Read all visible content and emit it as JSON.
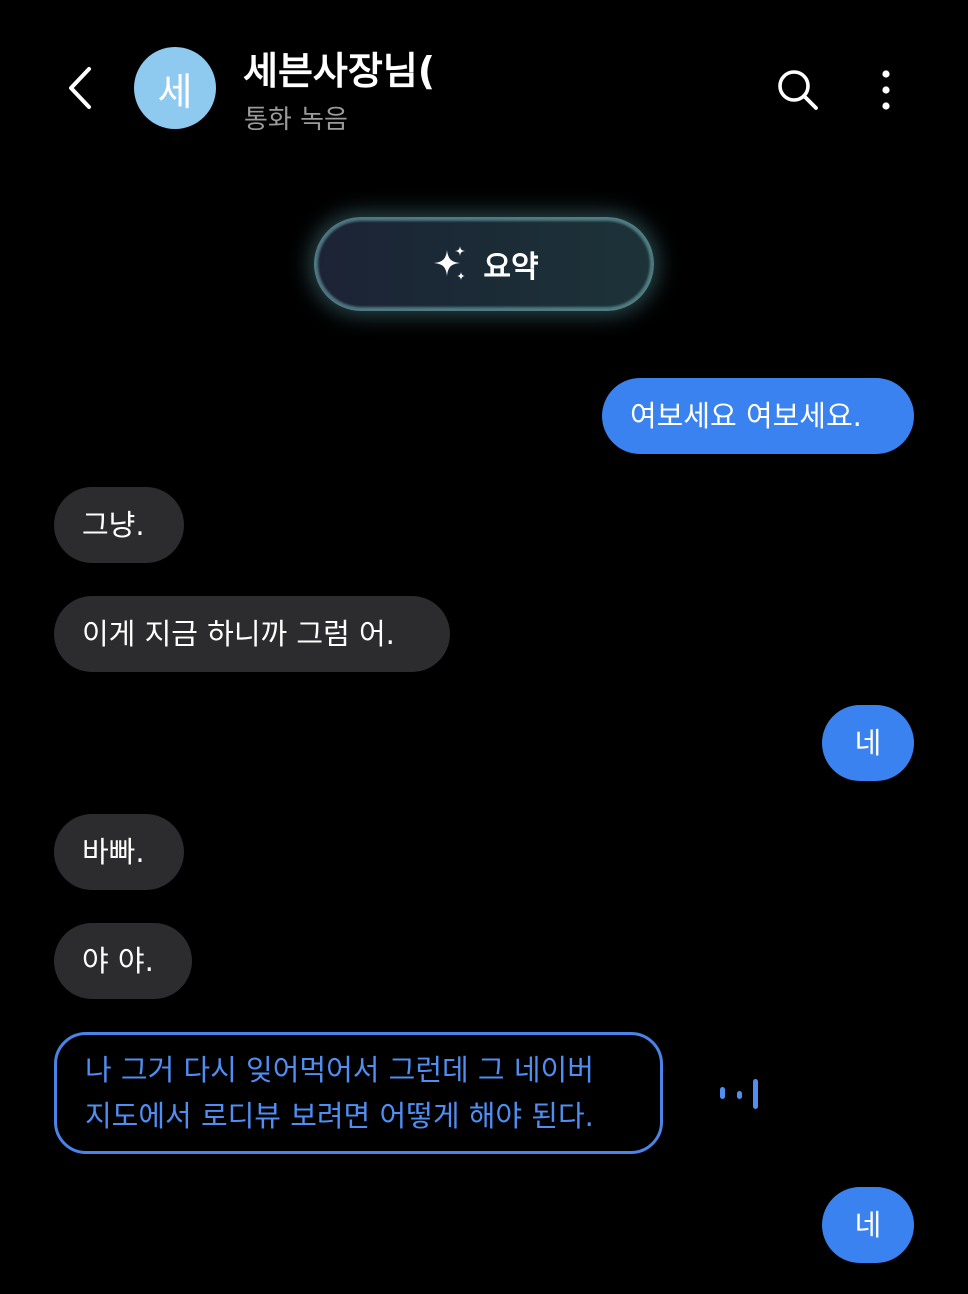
{
  "header": {
    "avatar_initial": "세",
    "contact_name": "세븐사장님(",
    "subtitle": "통화 녹음"
  },
  "summary": {
    "label": "요약"
  },
  "messages": [
    {
      "from": "me",
      "text": "여보세요 여보세요."
    },
    {
      "from": "them",
      "text": "그냥."
    },
    {
      "from": "them",
      "text": "이게 지금 하니까 그럼 어."
    },
    {
      "from": "me",
      "text": "네"
    },
    {
      "from": "them",
      "text": "바빠."
    },
    {
      "from": "them",
      "text": "야 야."
    },
    {
      "from": "them",
      "lines": [
        "나 그거 다시 잊어먹어서 그런데 그 네이버",
        "지도에서 로디뷰 보려면 어떻게 해야 된다."
      ],
      "state": "playing"
    },
    {
      "from": "me",
      "text": "네"
    }
  ],
  "icons": {
    "back": "chevron-left-icon",
    "search": "search-icon",
    "more": "more-vertical-icon",
    "summary": "sparkle-icon",
    "playing": "audio-playing-icon"
  },
  "colors": {
    "background": "#000000",
    "my_bubble": "#3a82f0",
    "their_bubble": "#2c2c2e",
    "active_outline": "#4a84e8",
    "avatar": "#8ec9ef"
  }
}
